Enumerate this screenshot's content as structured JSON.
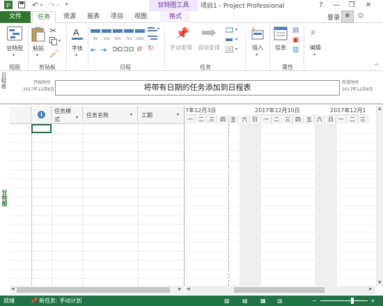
{
  "titlebar": {
    "context_tools": "甘特图工具",
    "window_title": "项目1 - Project Professional",
    "help": "?",
    "minimize": "—",
    "restore": "❐",
    "close": "✕"
  },
  "tabs": [
    "文件",
    "任务",
    "资源",
    "报表",
    "项目",
    "视图",
    "格式"
  ],
  "user": {
    "login": "登录"
  },
  "ribbon": {
    "gantt_chart": "甘特图",
    "paste": "粘贴",
    "font": "字体",
    "manual_schedule": "手动安排",
    "auto_schedule": "自动安排",
    "insert": "插入",
    "info": "信息",
    "edit": "编辑",
    "groups": {
      "view": "视图",
      "clipboard": "剪贴板",
      "schedule": "日程",
      "tasks": "任务",
      "properties": "属性"
    }
  },
  "timeline": {
    "side_label": "日程表",
    "start_label": "开始时间",
    "start_date": "2017年12月8日",
    "end_label": "完成时间",
    "end_date": "2017年12月8日",
    "placeholder": "将带有日期的任务添加到日程表"
  },
  "grid": {
    "side_label": "甘特图",
    "info_icon": "i",
    "columns": [
      "任务模式",
      "任务名称",
      "工期"
    ],
    "col_mode_line1": "任务模",
    "col_mode_line2": "式"
  },
  "gantt": {
    "weeks": [
      "7年12月3日",
      "2017年12月10日",
      "2017年12月1"
    ],
    "days": [
      "一",
      "二",
      "三",
      "四",
      "五",
      "六",
      "日",
      "一",
      "二",
      "三",
      "四",
      "五",
      "六",
      "日",
      "一",
      "二",
      "三"
    ]
  },
  "status": {
    "ready": "就绪",
    "new_tasks": "新任务: 手动计划",
    "zoom_minus": "−",
    "zoom_plus": "+"
  },
  "colors": {
    "accent": "#217346",
    "file_tab": "#31752f",
    "context": "#7030a0"
  }
}
